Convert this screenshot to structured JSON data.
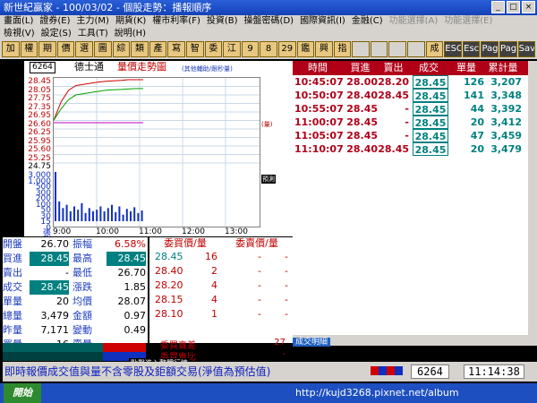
{
  "window": {
    "title": "新世紀贏家 - 100/03/02 - 個股走勢：播報順序"
  },
  "menu": {
    "row1": [
      "畫面(L)",
      "證券(E)",
      "主力(M)",
      "期貨(K)",
      "權市利率(F)",
      "投資(B)",
      "操盤密碼(D)",
      "國際資訊(I)",
      "金融(C)",
      "功能選擇(A)",
      "功能選擇(E)"
    ],
    "row2": [
      "檢視(V)",
      "設定(S)",
      "工具(T)",
      "說明(H)"
    ]
  },
  "toolbar": {
    "buttons": [
      "加",
      "權",
      "期",
      "價",
      "選",
      "圖",
      "綜",
      "類",
      "產",
      "寫",
      "智",
      "委",
      "江",
      "9",
      "8",
      "29",
      "鑑",
      "興",
      "指",
      "",
      "",
      "",
      "",
      "成",
      "ESC",
      "Esc",
      "Page",
      "Page",
      "Save"
    ]
  },
  "chart": {
    "code": "6264",
    "name": "德士通",
    "title": "量價走勢圖",
    "subtitle": "(其他輔助/跟秒量)",
    "right_label_1": "(量)",
    "right_label_2": "預測"
  },
  "chart_data": {
    "type": "line",
    "price_ticks": [
      "28.45",
      "28.05",
      "27.75",
      "27.35",
      "26.95",
      "26.60",
      "26.25",
      "25.95",
      "25.60",
      "25.25",
      "24.75"
    ],
    "volume_ticks": [
      "3,000",
      "1,000",
      "500",
      "300",
      "200",
      "100",
      "50",
      "30",
      "15",
      "0"
    ],
    "volume_unit": "張",
    "x_ticks": [
      "9:00",
      "10:00",
      "11:00",
      "12:00",
      "13:00"
    ],
    "series": [
      {
        "values": [
          26.7,
          27.5,
          28.0,
          28.2,
          28.25,
          28.3,
          28.35,
          28.38,
          28.4,
          28.42,
          28.45,
          28.45,
          28.45
        ]
      },
      {
        "values": [
          26.7,
          27.2,
          27.6,
          27.8,
          27.85,
          27.9,
          27.95,
          28.0,
          28.02,
          28.03,
          28.05,
          28.07,
          28.07
        ]
      }
    ],
    "ref_price": 26.6,
    "volumes": [
      300,
      120,
      80,
      100,
      60,
      90,
      70,
      110,
      50,
      80,
      60,
      70,
      90,
      60,
      80,
      100,
      55,
      90,
      40,
      75,
      60,
      85,
      50,
      65
    ],
    "colors": {
      "price": "#d00000",
      "avg": "#00a000",
      "ref": "#c000c0",
      "vol": "#1030c0",
      "grid": "#c8d8e8"
    }
  },
  "trades": {
    "headers": [
      "時間",
      "買進",
      "賣出",
      "成交",
      "單量",
      "累計量"
    ],
    "rows": [
      {
        "time": "10:45:07",
        "bid": "28.00",
        "ask": "28.20",
        "price": "28.45",
        "vol": "126",
        "cum": "3,207"
      },
      {
        "time": "10:50:07",
        "bid": "28.40",
        "ask": "28.45",
        "price": "28.45",
        "vol": "141",
        "cum": "3,348"
      },
      {
        "time": "10:55:07",
        "bid": "28.45",
        "ask": "-",
        "price": "28.45",
        "vol": "44",
        "cum": "3,392"
      },
      {
        "time": "11:00:07",
        "bid": "28.45",
        "ask": "-",
        "price": "28.45",
        "vol": "20",
        "cum": "3,412"
      },
      {
        "time": "11:05:07",
        "bid": "28.45",
        "ask": "-",
        "price": "28.45",
        "vol": "47",
        "cum": "3,459"
      },
      {
        "time": "11:10:07",
        "bid": "28.40",
        "ask": "28.45",
        "price": "28.45",
        "vol": "20",
        "cum": "3,479"
      }
    ],
    "footer_tab": "成交明細"
  },
  "info": {
    "rows": [
      [
        "開盤",
        "26.70",
        "振幅",
        "6.58%"
      ],
      [
        "買進",
        "28.45",
        "最高",
        "28.45"
      ],
      [
        "賣出",
        "-",
        "最低",
        "26.70"
      ],
      [
        "成交",
        "28.45",
        "漲跌",
        "1.85"
      ],
      [
        "單量",
        "20",
        "均價",
        "28.07"
      ],
      [
        "總量",
        "3,479",
        "金額",
        "0.97"
      ],
      [
        "昨量",
        "7,171",
        "變動",
        "0.49"
      ],
      [
        "買量",
        "16",
        "賣量",
        "-"
      ]
    ]
  },
  "orders": {
    "headers": [
      "委買價/量",
      "委賣價/量"
    ],
    "rows": [
      {
        "bp": "28.45",
        "bq": "16",
        "sp": "-",
        "sq": "-"
      },
      {
        "bp": "28.40",
        "bq": "2",
        "sp": "-",
        "sq": "-"
      },
      {
        "bp": "28.20",
        "bq": "4",
        "sp": "-",
        "sq": "-"
      },
      {
        "bp": "28.15",
        "bq": "4",
        "sp": "-",
        "sq": "-"
      },
      {
        "bp": "28.10",
        "bq": "1",
        "sp": "-",
        "sq": "-"
      }
    ],
    "diff_label": "委買賣差",
    "diff_value": "27",
    "ratio_label": "委買賣比",
    "ratio_value": "-",
    "tooltip": "點擊進入整體行情"
  },
  "status": {
    "text": "即時報價成交值與量不含零股及鉅額交易(淨值為預估值)",
    "code": "6264",
    "clock": "11:14:38"
  },
  "taskbar": {
    "start": "開始",
    "url": "http://kujd3268.pixnet.net/album"
  }
}
